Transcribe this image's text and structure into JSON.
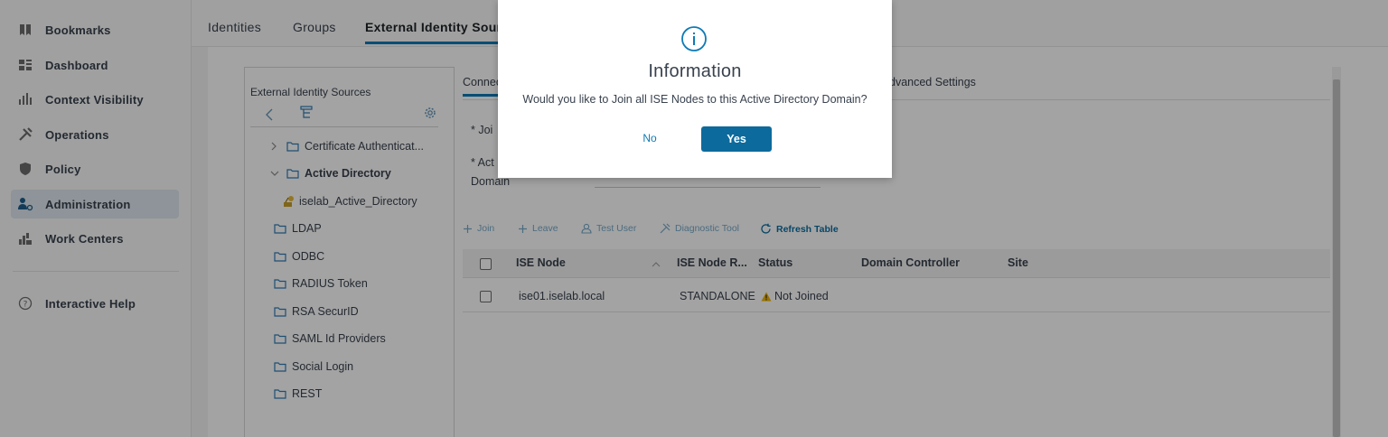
{
  "sidebar": {
    "items": [
      {
        "label": "Bookmarks",
        "icon": "bookmark-icon"
      },
      {
        "label": "Dashboard",
        "icon": "dashboard-icon"
      },
      {
        "label": "Context Visibility",
        "icon": "context-visibility-icon"
      },
      {
        "label": "Operations",
        "icon": "operations-icon"
      },
      {
        "label": "Policy",
        "icon": "policy-icon"
      },
      {
        "label": "Administration",
        "icon": "administration-icon",
        "active": true
      },
      {
        "label": "Work Centers",
        "icon": "work-centers-icon"
      }
    ],
    "help": {
      "label": "Interactive Help",
      "icon": "help-icon"
    }
  },
  "tabs": [
    "Identities",
    "Groups",
    "External Identity Sources"
  ],
  "active_tab": "External Identity Sources",
  "left_panel": {
    "title": "External Identity Sources",
    "tree": [
      {
        "label": "Certificate Authenticat...",
        "expandable": true
      },
      {
        "label": "Active Directory",
        "expanded": true
      },
      {
        "label": "iselab_Active_Directory",
        "child": true
      },
      {
        "label": "LDAP"
      },
      {
        "label": "ODBC"
      },
      {
        "label": "RADIUS Token"
      },
      {
        "label": "RSA SecurID"
      },
      {
        "label": "SAML Id Providers"
      },
      {
        "label": "Social Login"
      },
      {
        "label": "REST"
      }
    ]
  },
  "right_tabs": {
    "first": "Connec",
    "advanced": "dvanced Settings"
  },
  "form": {
    "join_label": "* Joi",
    "active_label": "* Act",
    "domain_label": "Domain"
  },
  "toolbar": {
    "join": "Join",
    "leave": "Leave",
    "test_user": "Test User",
    "diagnostic_tool": "Diagnostic Tool",
    "refresh_table": "Refresh Table"
  },
  "table": {
    "columns": [
      "ISE Node",
      "ISE Node R...",
      "Status",
      "Domain Controller",
      "Site"
    ],
    "rows": [
      {
        "node": "ise01.iselab.local",
        "role": "STANDALONE",
        "status": "Not Joined"
      }
    ]
  },
  "modal": {
    "title": "Information",
    "message": "Would you like to Join all ISE Nodes to this Active Directory Domain?",
    "no_label": "No",
    "yes_label": "Yes"
  },
  "colors": {
    "accent": "#0d7bb7",
    "primary_button": "#0d6a9c",
    "warning": "#f0b400"
  }
}
